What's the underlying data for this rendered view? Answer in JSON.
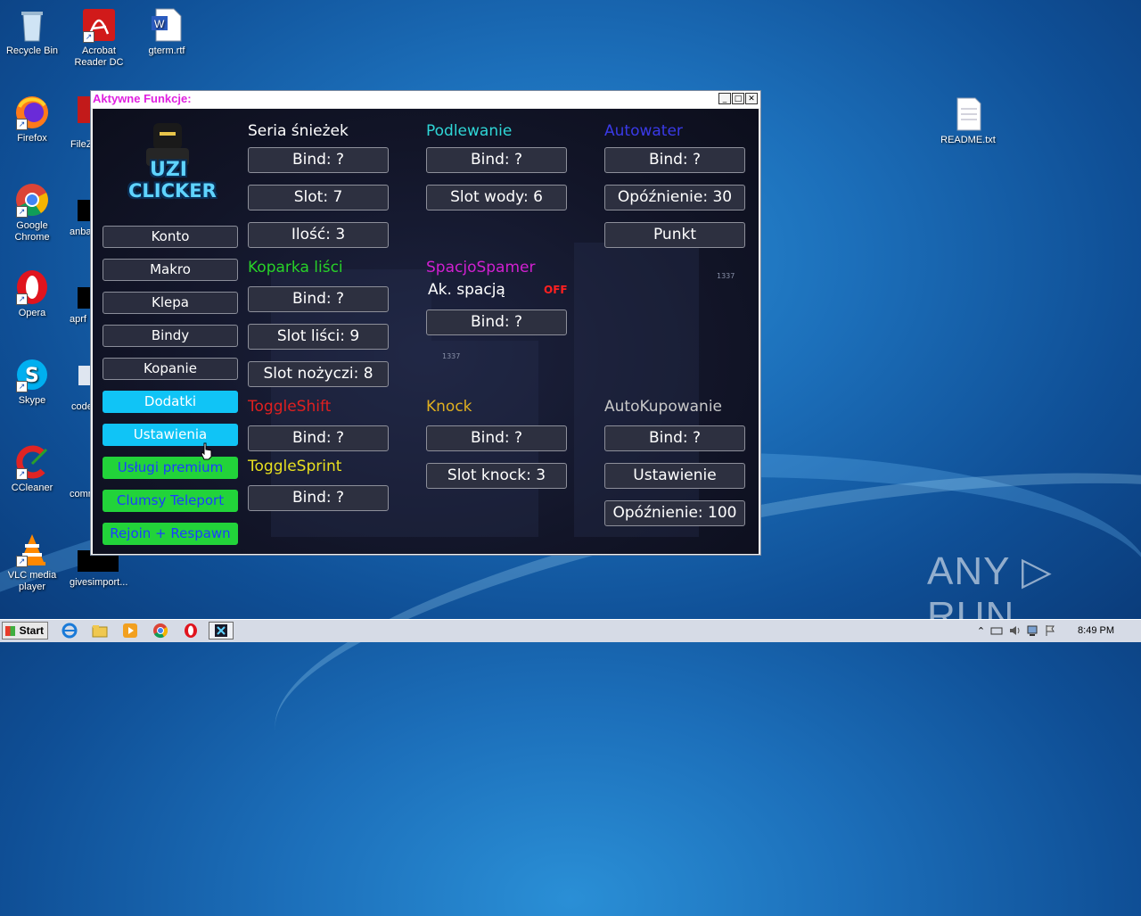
{
  "desktop": {
    "icons": [
      {
        "label": "Recycle Bin"
      },
      {
        "label": "Acrobat Reader DC"
      },
      {
        "label": "gterm.rtf"
      },
      {
        "label": "Firefox"
      },
      {
        "label": "Google Chrome"
      },
      {
        "label": "Opera"
      },
      {
        "label": "Skype"
      },
      {
        "label": "CCleaner"
      },
      {
        "label": "VLC media player"
      },
      {
        "label": "README.txt"
      }
    ],
    "partial_labels": [
      "FileZ",
      "anba",
      "aprf",
      "code",
      "comr",
      "givesimport..."
    ]
  },
  "window": {
    "title": "Aktywne Funkcje:",
    "minimize": "_",
    "maximize": "□",
    "close": "✕"
  },
  "logo": {
    "line1": "UZI",
    "line2": "CLICKER"
  },
  "nav": [
    {
      "label": "Konto",
      "style": "dark"
    },
    {
      "label": "Makro",
      "style": "dark"
    },
    {
      "label": "Klepa",
      "style": "dark"
    },
    {
      "label": "Bindy",
      "style": "dark"
    },
    {
      "label": "Kopanie",
      "style": "dark"
    },
    {
      "label": "Dodatki",
      "style": "cyan"
    },
    {
      "label": "Ustawienia",
      "style": "cyan"
    },
    {
      "label": "Usługi premium",
      "style": "green"
    },
    {
      "label": "Clumsy Teleport",
      "style": "green"
    },
    {
      "label": "Rejoin + Respawn",
      "style": "green"
    }
  ],
  "sections": {
    "seria": {
      "title": "Seria śnieżek",
      "color": "#ffffff",
      "bind": "Bind: ?",
      "slot": "Slot: 7",
      "ilosc": "Ilość: 3"
    },
    "podlewanie": {
      "title": "Podlewanie",
      "color": "#2fd6d6",
      "bind": "Bind: ?",
      "slot": "Slot wody: 6"
    },
    "autowater": {
      "title": "Autowater",
      "color": "#3a3ae8",
      "bind": "Bind: ?",
      "delay": "Opóźnienie: 30",
      "punkt": "Punkt"
    },
    "koparka": {
      "title": "Koparka liści",
      "color": "#28d228",
      "bind": "Bind: ?",
      "slot_lisci": "Slot liści: 9",
      "slot_nozyczi": "Slot nożyczi: 8"
    },
    "spacjo": {
      "title": "SpacjoSpamer",
      "color": "#d020d0",
      "label": "Ak. spacją",
      "state": "OFF",
      "bind": "Bind: ?"
    },
    "toggleshift": {
      "title": "ToggleShift",
      "color": "#e02020",
      "bind": "Bind: ?"
    },
    "togglesprint": {
      "title": "ToggleSprint",
      "color": "#e8e020",
      "bind": "Bind: ?"
    },
    "knock": {
      "title": "Knock",
      "color": "#e0b020",
      "bind": "Bind: ?",
      "slot": "Slot knock: 3"
    },
    "autokupowanie": {
      "title": "AutoKupowanie",
      "color": "#c8c8c8",
      "bind": "Bind: ?",
      "ustawienie": "Ustawienie",
      "delay": "Opóźnienie: 100"
    }
  },
  "misc": {
    "tiny1": "1337",
    "tiny2": "1337"
  },
  "watermark": "ANY ▷ RUN",
  "taskbar": {
    "start": "Start",
    "clock": "8:49 PM"
  }
}
